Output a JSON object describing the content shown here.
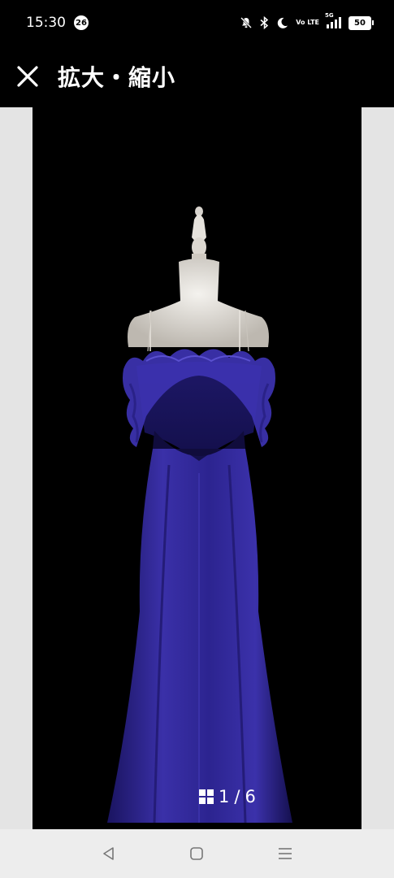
{
  "status_bar": {
    "time": "15:30",
    "notification_count": "26",
    "volte": "Vo LTE",
    "network": "5G",
    "battery": "50"
  },
  "header": {
    "close_icon": "close-icon",
    "title": "拡大・縮小"
  },
  "viewer": {
    "image_subject": "purple-ruffle-gown-on-mannequin",
    "counter": {
      "icon": "gallery-grid-icon",
      "current": "1",
      "separator": "/",
      "total": "6"
    }
  },
  "nav_bar": {
    "back_icon": "back-triangle-icon",
    "home_icon": "home-square-icon",
    "recents_icon": "recents-menu-icon"
  },
  "colors": {
    "background": "#000000",
    "side_gutter": "#e4e4e4",
    "nav_bar": "#ededed",
    "dress": "#2e2590"
  }
}
